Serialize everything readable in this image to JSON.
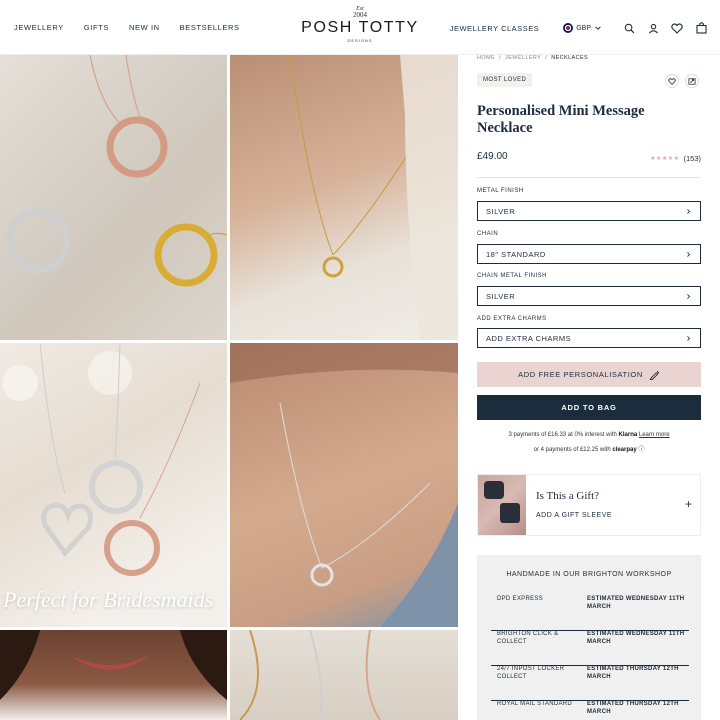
{
  "header": {
    "nav_left": [
      "JEWELLERY",
      "GIFTS",
      "NEW IN",
      "BESTSELLERS"
    ],
    "logo": {
      "est": "Est",
      "year": "2004",
      "name": "POSH TOTTY",
      "tagline": "DESIGNS"
    },
    "classes": "JEWELLERY CLASSES",
    "currency": "GBP"
  },
  "gallery": {
    "overlay_text": "Perfect for Bridesmaids"
  },
  "product": {
    "breadcrumb": [
      "HOME",
      "JEWELLERY",
      "NECKLACES"
    ],
    "badge": "MOST LOVED",
    "title": "Personalised Mini Message Necklace",
    "price": "£49.00",
    "rating_stars": 5,
    "review_count": "(153)",
    "options": [
      {
        "label": "METAL FINISH",
        "value": "SILVER"
      },
      {
        "label": "CHAIN",
        "value": "18\" STANDARD"
      },
      {
        "label": "CHAIN METAL FINISH",
        "value": "SILVER"
      },
      {
        "label": "ADD EXTRA CHARMS",
        "value": "ADD EXTRA CHARMS"
      }
    ],
    "personalise_label": "ADD FREE PERSONALISATION",
    "add_to_bag": "ADD TO BAG",
    "payment": {
      "line1_pre": "3 payments of £16.33 at 0% interest with",
      "klarna": "Klarna",
      "learn_more": "Learn more",
      "line2_pre": "or 4 payments of £12.25 with",
      "clearpay": "clearpay",
      "info": "ⓘ"
    },
    "gift": {
      "title": "Is This a Gift?",
      "subtitle": "ADD A GIFT SLEEVE",
      "plus": "+"
    },
    "delivery": {
      "heading": "HANDMADE IN OUR BRIGHTON WORKSHOP",
      "rows": [
        {
          "method": "DPD EXPRESS",
          "estimate": "ESTIMATED WEDNESDAY 11TH MARCH"
        },
        {
          "method": "BRIGHTON CLICK & COLLECT",
          "estimate": "ESTIMATED WEDNESDAY 11TH MARCH"
        },
        {
          "method": "24/7 INPOST LOCKER COLLECT",
          "estimate": "ESTIMATED THURSDAY 12TH MARCH"
        },
        {
          "method": "ROYAL MAIL STANDARD",
          "estimate": "ESTIMATED THURSDAY 12TH MARCH"
        }
      ]
    }
  },
  "colors": {
    "navy": "#1b2c3c",
    "blush": "#ead4d2",
    "badge_bg": "#f1f0ea",
    "star": "#e5a2aa"
  }
}
